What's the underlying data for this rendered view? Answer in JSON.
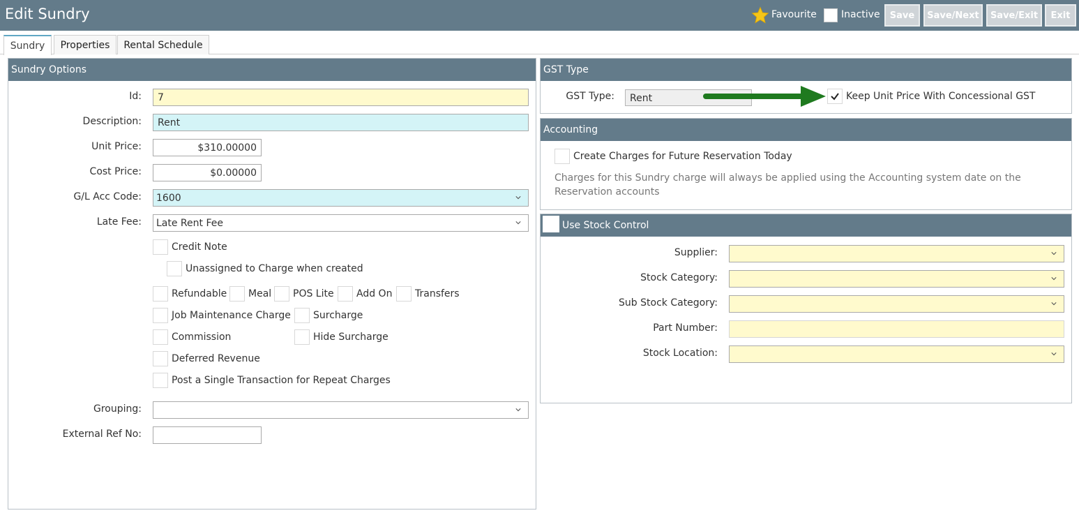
{
  "header": {
    "title": "Edit Sundry",
    "favourite_label": "Favourite",
    "inactive_label": "Inactive",
    "buttons": {
      "save": "Save",
      "save_next": "Save/Next",
      "save_exit": "Save/Exit",
      "exit": "Exit"
    }
  },
  "tabs": [
    {
      "label": "Sundry",
      "active": true
    },
    {
      "label": "Properties",
      "active": false
    },
    {
      "label": "Rental Schedule",
      "active": false
    }
  ],
  "sundry_options": {
    "heading": "Sundry Options",
    "id_label": "Id:",
    "id_value": "7",
    "description_label": "Description:",
    "description_value": "Rent",
    "unit_price_label": "Unit Price:",
    "unit_price_value": "$310.00000",
    "cost_price_label": "Cost Price:",
    "cost_price_value": "$0.00000",
    "gl_label": "G/L Acc Code:",
    "gl_value": "1600",
    "late_fee_label": "Late Fee:",
    "late_fee_value": "Late Rent Fee",
    "credit_note": "Credit Note",
    "unassigned": "Unassigned to Charge when created",
    "refundable": "Refundable",
    "meal": "Meal",
    "pos_lite": "POS Lite",
    "add_on": "Add On",
    "transfers": "Transfers",
    "job_maintenance": "Job Maintenance Charge",
    "surcharge": "Surcharge",
    "commission": "Commission",
    "hide_surcharge": "Hide Surcharge",
    "deferred_revenue": "Deferred Revenue",
    "post_single": "Post a Single Transaction for Repeat Charges",
    "grouping_label": "Grouping:",
    "grouping_value": "",
    "external_ref_label": "External Ref No:",
    "external_ref_value": ""
  },
  "gst": {
    "heading": "GST Type",
    "type_label": "GST Type:",
    "type_value": "Rent",
    "keep_unit_price": "Keep Unit Price With Concessional GST",
    "keep_unit_price_checked": true,
    "arrow_color": "#1f7a1f"
  },
  "accounting": {
    "heading": "Accounting",
    "create_charges": "Create Charges for Future Reservation Today",
    "note_line1": "Charges for this Sundry charge will always be applied using the Accounting system date on the",
    "note_line2": "Reservation accounts"
  },
  "stock": {
    "heading": "Use Stock Control",
    "supplier_label": "Supplier:",
    "stock_category_label": "Stock Category:",
    "sub_stock_category_label": "Sub Stock Category:",
    "part_number_label": "Part Number:",
    "stock_location_label": "Stock Location:"
  },
  "colors": {
    "header_bg": "#637b8a",
    "accent_tab": "#5fa7c4",
    "yellow_field": "#fffacd",
    "cyan_field": "#d4f4f7",
    "star": "#f5c518"
  }
}
